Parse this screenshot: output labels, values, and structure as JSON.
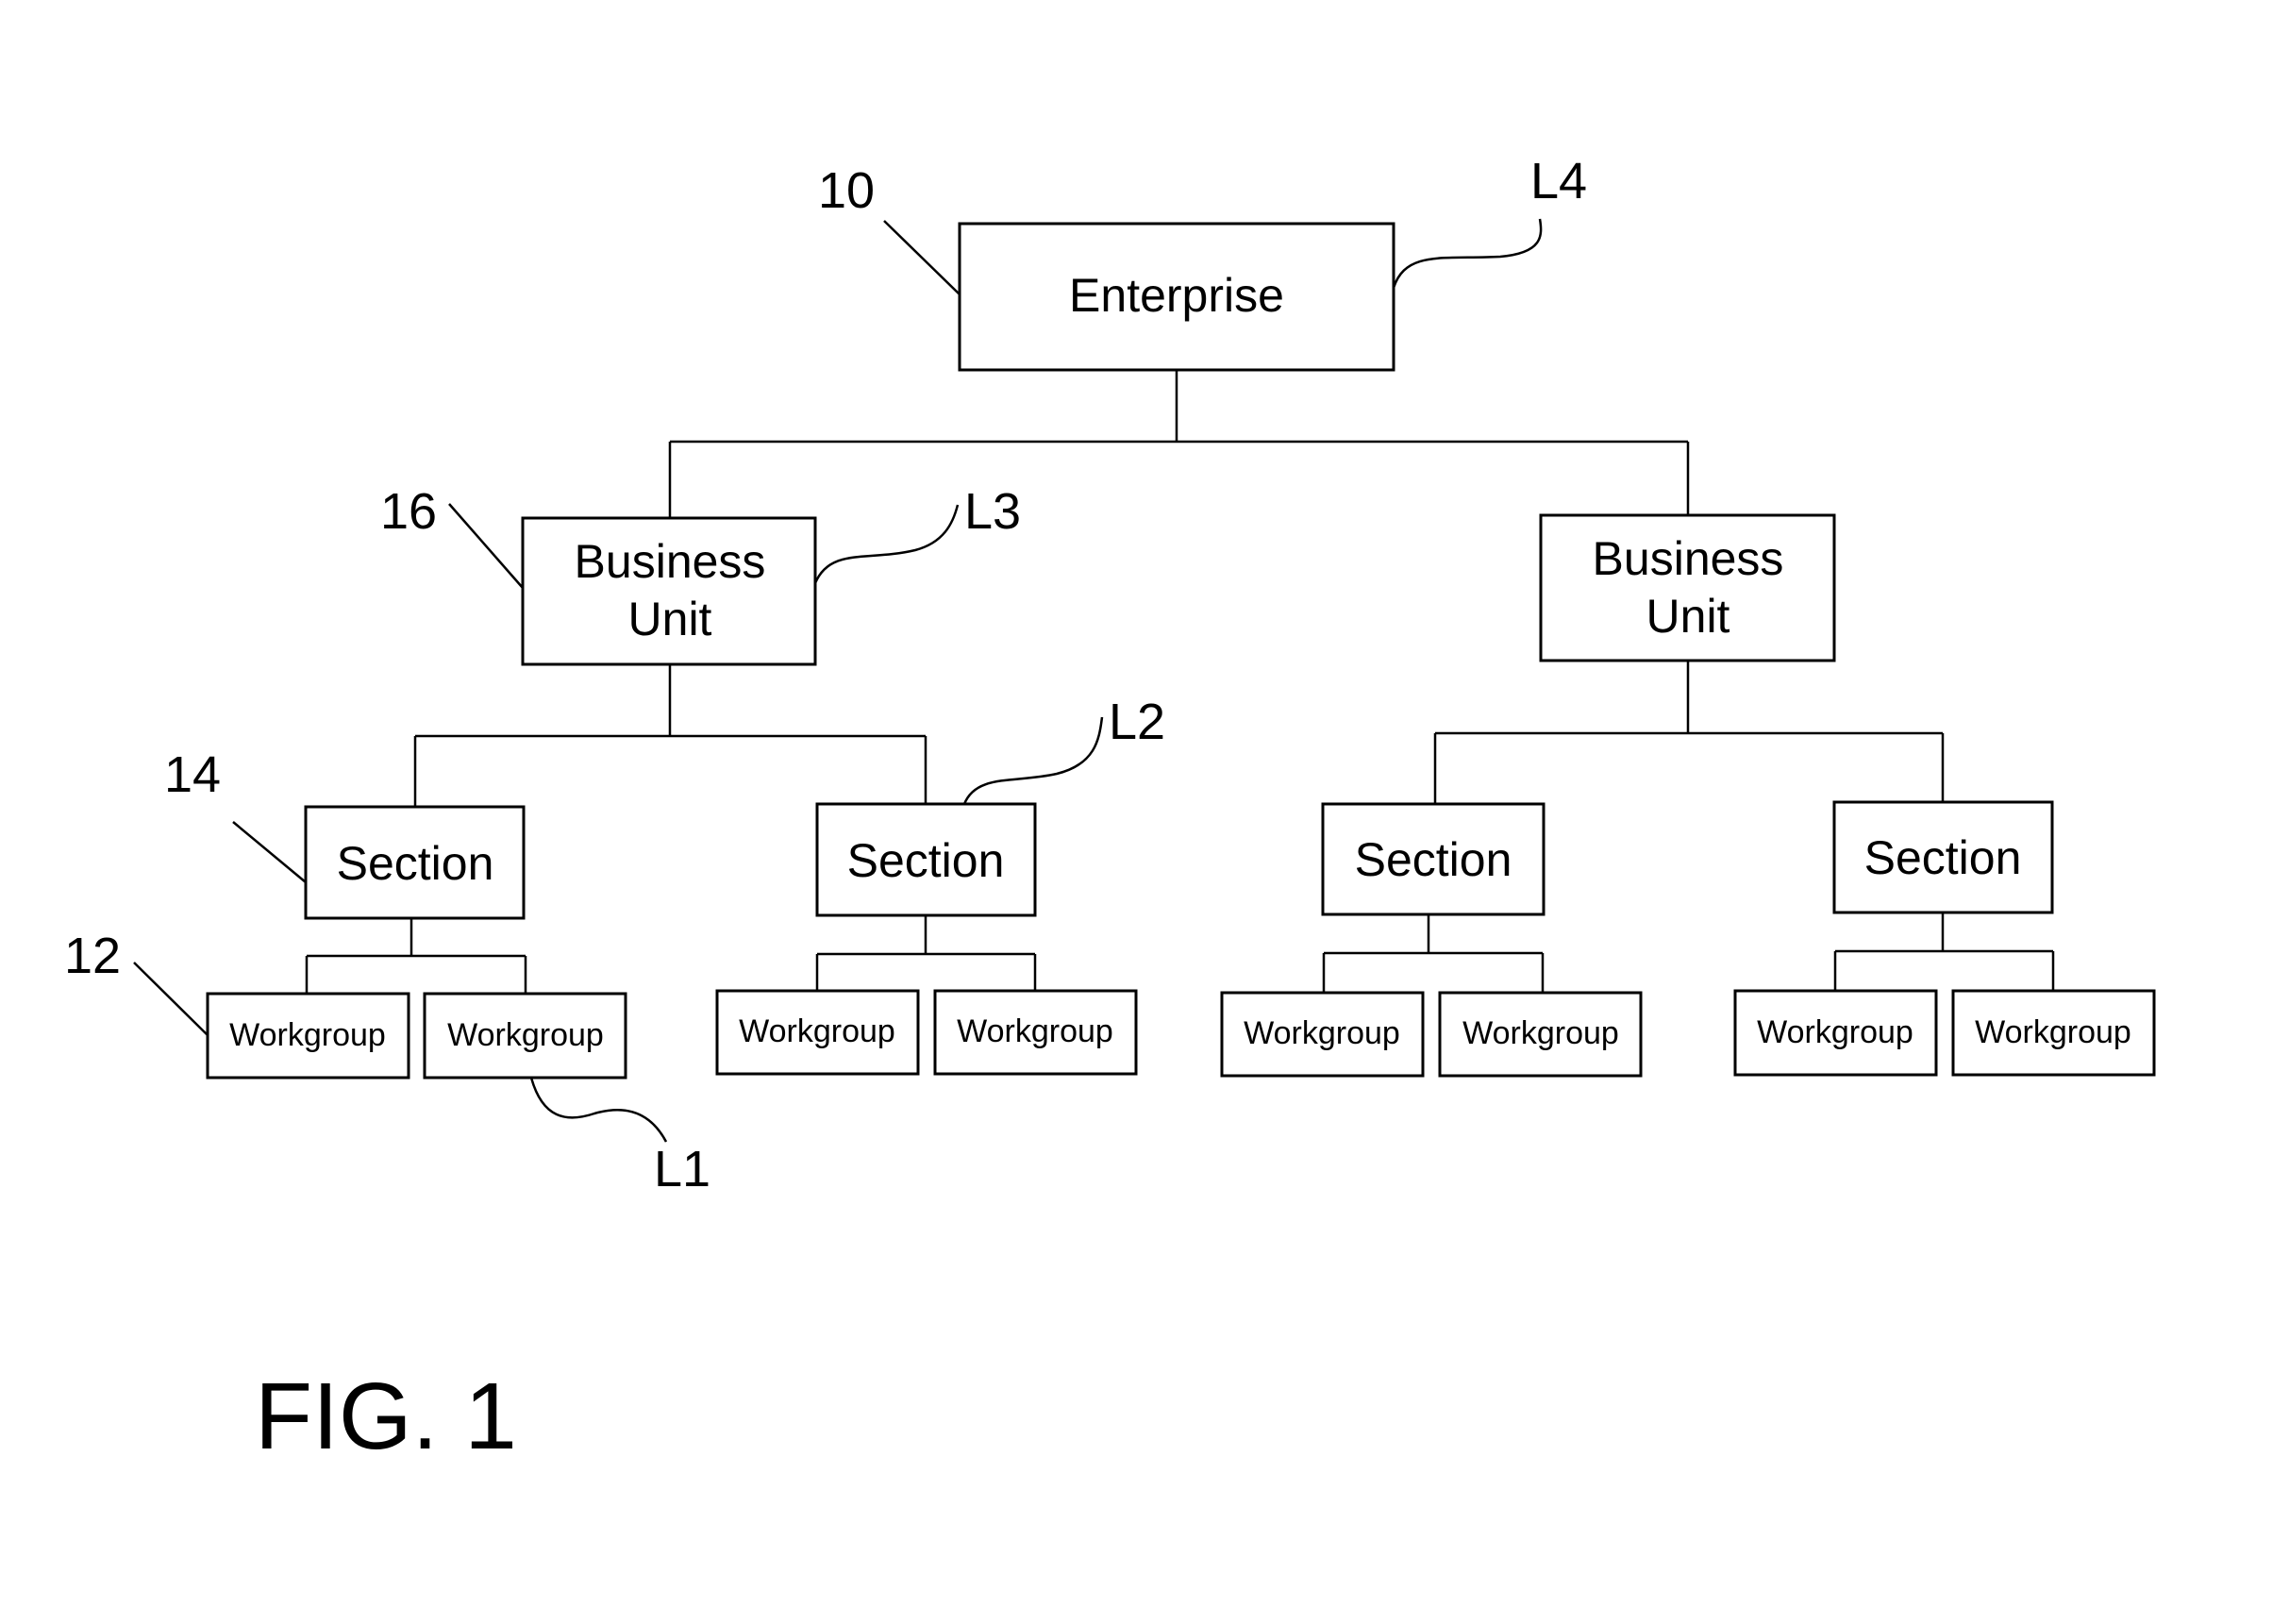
{
  "figure_label": "FIG. 1",
  "nodes": {
    "enterprise": "Enterprise",
    "bu_left": [
      "Business",
      "Unit"
    ],
    "bu_right": [
      "Business",
      "Unit"
    ],
    "sections": [
      "Section",
      "Section",
      "Section",
      "Section"
    ],
    "workgroups": [
      "Workgroup",
      "Workgroup",
      "Workgroup",
      "Workgroup",
      "Workgroup",
      "Workgroup",
      "Workgroup",
      "Workgroup"
    ]
  },
  "reference_numerals": {
    "enterprise": "10",
    "business_unit": "16",
    "section": "14",
    "workgroup": "12"
  },
  "level_labels": {
    "L1": "L1",
    "L2": "L2",
    "L3": "L3",
    "L4": "L4"
  }
}
